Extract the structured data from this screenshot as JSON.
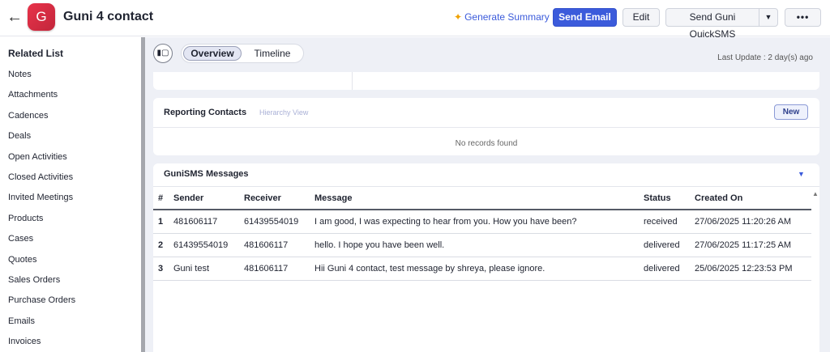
{
  "header": {
    "avatar_letter": "G",
    "title": "Guni 4 contact",
    "generate_summary": "Generate Summary",
    "send_email": "Send Email",
    "edit": "Edit",
    "send_quick_sms": "Send Guni QuickSMS",
    "more": "•••",
    "accent_color": "#3b5bdb"
  },
  "sidebar": {
    "title": "Related List",
    "items": [
      "Notes",
      "Attachments",
      "Cadences",
      "Deals",
      "Open Activities",
      "Closed Activities",
      "Invited Meetings",
      "Products",
      "Cases",
      "Quotes",
      "Sales Orders",
      "Purchase Orders",
      "Emails",
      "Invoices"
    ]
  },
  "toolbar": {
    "tabs": [
      "Overview",
      "Timeline"
    ],
    "active_tab": "Overview",
    "last_update": "Last Update : 2 day(s) ago"
  },
  "reporting": {
    "title": "Reporting Contacts",
    "hierarchy": "Hierarchy View",
    "new": "New",
    "empty": "No records found"
  },
  "sms": {
    "title": "GuniSMS Messages",
    "columns": [
      "#",
      "Sender",
      "Receiver",
      "Message",
      "Status",
      "Created On"
    ],
    "rows": [
      [
        "1",
        "481606117",
        "61439554019",
        "I am good, I was expecting to hear from you. How you have been?",
        "received",
        "27/06/2025 11:20:26 AM"
      ],
      [
        "2",
        "61439554019",
        "481606117",
        "hello. I hope you have been well.",
        "delivered",
        "27/06/2025 11:17:25 AM"
      ],
      [
        "3",
        "Guni test",
        "481606117",
        "Hii Guni 4 contact, test message by shreya, please ignore.",
        "delivered",
        "25/06/2025 12:23:53 PM"
      ]
    ]
  }
}
